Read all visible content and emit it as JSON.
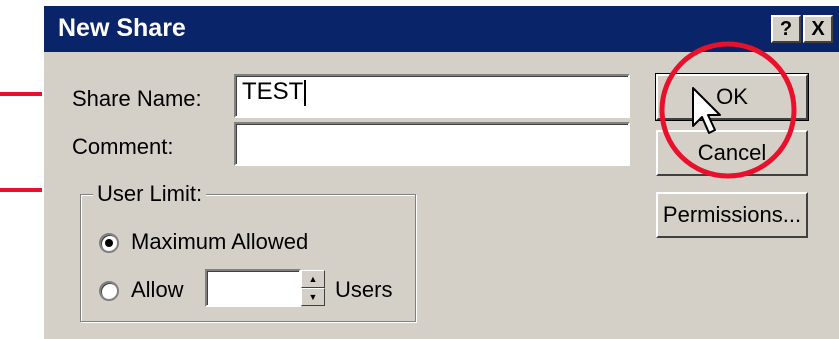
{
  "window": {
    "title": "New Share",
    "help_label": "?",
    "close_label": "X"
  },
  "form": {
    "share_name_label": "Share Name:",
    "share_name_value": "TEST",
    "comment_label": "Comment:",
    "comment_value": ""
  },
  "user_limit": {
    "legend": "User Limit:",
    "maximum_label": "Maximum Allowed",
    "maximum_selected": true,
    "allow_label": "Allow",
    "allow_selected": false,
    "allow_value": "",
    "users_label": "Users"
  },
  "buttons": {
    "ok": "OK",
    "cancel": "Cancel",
    "permissions": "Permissions..."
  },
  "annotation": {
    "arrow_color": "#e8102a",
    "circle_color": "#e8102a"
  },
  "colors": {
    "titlebar": "#0a246a",
    "dialog": "#d4d0c8"
  }
}
